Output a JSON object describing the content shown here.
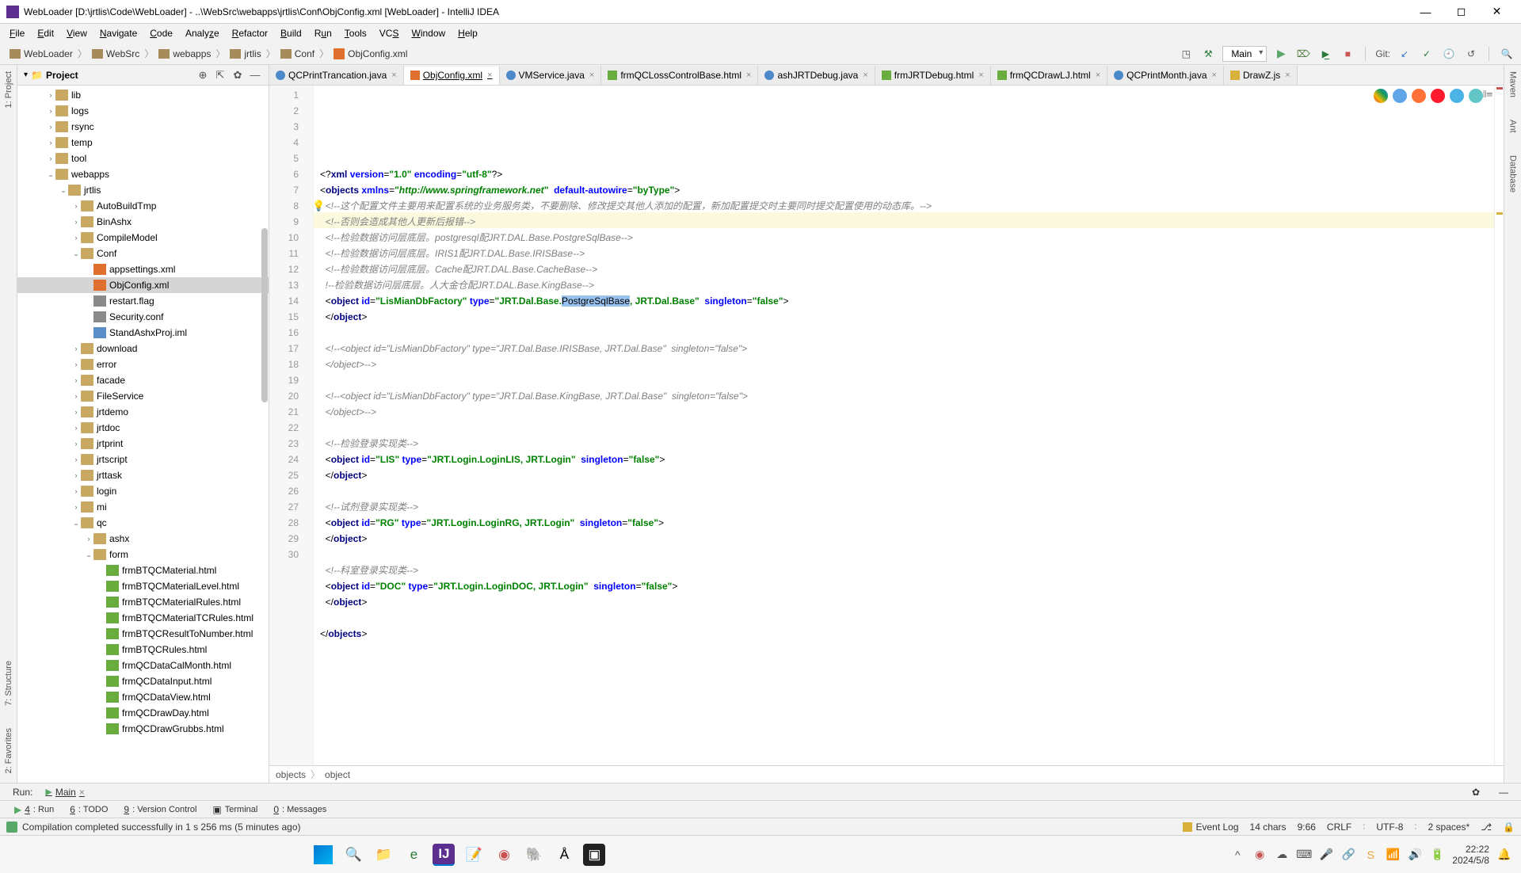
{
  "window": {
    "title": "WebLoader [D:\\jrtlis\\Code\\WebLoader] - ..\\WebSrc\\webapps\\jrtlis\\Conf\\ObjConfig.xml [WebLoader] - IntelliJ IDEA",
    "minimize": "—",
    "maximize": "◻",
    "close": "✕"
  },
  "menu": {
    "items": [
      "File",
      "Edit",
      "View",
      "Navigate",
      "Code",
      "Analyze",
      "Refactor",
      "Build",
      "Run",
      "Tools",
      "VCS",
      "Window",
      "Help"
    ]
  },
  "breadcrumb": {
    "root": "WebLoader",
    "parts": [
      "WebSrc",
      "webapps",
      "jrtlis",
      "Conf",
      "ObjConfig.xml"
    ]
  },
  "toolbar": {
    "run_config": "Main",
    "git_label": "Git:"
  },
  "project": {
    "header": "Project",
    "nodes": [
      {
        "indent": 1,
        "type": "folder",
        "arrow": "›",
        "label": "lib"
      },
      {
        "indent": 1,
        "type": "folder",
        "arrow": "›",
        "label": "logs"
      },
      {
        "indent": 1,
        "type": "folder",
        "arrow": "›",
        "label": "rsync"
      },
      {
        "indent": 1,
        "type": "folder",
        "arrow": "›",
        "label": "temp"
      },
      {
        "indent": 1,
        "type": "folder",
        "arrow": "›",
        "label": "tool"
      },
      {
        "indent": 1,
        "type": "folder",
        "arrow": "⌄",
        "label": "webapps"
      },
      {
        "indent": 2,
        "type": "folder",
        "arrow": "⌄",
        "label": "jrtlis"
      },
      {
        "indent": 3,
        "type": "folder",
        "arrow": "›",
        "label": "AutoBuildTmp"
      },
      {
        "indent": 3,
        "type": "folder",
        "arrow": "›",
        "label": "BinAshx"
      },
      {
        "indent": 3,
        "type": "folder",
        "arrow": "›",
        "label": "CompileModel"
      },
      {
        "indent": 3,
        "type": "folder",
        "arrow": "⌄",
        "label": "Conf"
      },
      {
        "indent": 4,
        "type": "file-xml",
        "arrow": "",
        "label": "appsettings.xml"
      },
      {
        "indent": 4,
        "type": "file-xml",
        "arrow": "",
        "label": "ObjConfig.xml",
        "selected": true
      },
      {
        "indent": 4,
        "type": "file-txt",
        "arrow": "",
        "label": "restart.flag"
      },
      {
        "indent": 4,
        "type": "file-txt",
        "arrow": "",
        "label": "Security.conf"
      },
      {
        "indent": 4,
        "type": "file-iml",
        "arrow": "",
        "label": "StandAshxProj.iml"
      },
      {
        "indent": 3,
        "type": "folder",
        "arrow": "›",
        "label": "download"
      },
      {
        "indent": 3,
        "type": "folder",
        "arrow": "›",
        "label": "error"
      },
      {
        "indent": 3,
        "type": "folder",
        "arrow": "›",
        "label": "facade"
      },
      {
        "indent": 3,
        "type": "folder",
        "arrow": "›",
        "label": "FileService"
      },
      {
        "indent": 3,
        "type": "folder",
        "arrow": "›",
        "label": "jrtdemo"
      },
      {
        "indent": 3,
        "type": "folder",
        "arrow": "›",
        "label": "jrtdoc"
      },
      {
        "indent": 3,
        "type": "folder",
        "arrow": "›",
        "label": "jrtprint"
      },
      {
        "indent": 3,
        "type": "folder",
        "arrow": "›",
        "label": "jrtscript"
      },
      {
        "indent": 3,
        "type": "folder",
        "arrow": "›",
        "label": "jrttask"
      },
      {
        "indent": 3,
        "type": "folder",
        "arrow": "›",
        "label": "login"
      },
      {
        "indent": 3,
        "type": "folder",
        "arrow": "›",
        "label": "mi"
      },
      {
        "indent": 3,
        "type": "folder",
        "arrow": "⌄",
        "label": "qc"
      },
      {
        "indent": 4,
        "type": "folder",
        "arrow": "›",
        "label": "ashx"
      },
      {
        "indent": 4,
        "type": "folder",
        "arrow": "⌄",
        "label": "form"
      },
      {
        "indent": 5,
        "type": "file-html",
        "arrow": "",
        "label": "frmBTQCMaterial.html"
      },
      {
        "indent": 5,
        "type": "file-html",
        "arrow": "",
        "label": "frmBTQCMaterialLevel.html"
      },
      {
        "indent": 5,
        "type": "file-html",
        "arrow": "",
        "label": "frmBTQCMaterialRules.html"
      },
      {
        "indent": 5,
        "type": "file-html",
        "arrow": "",
        "label": "frmBTQCMaterialTCRules.html"
      },
      {
        "indent": 5,
        "type": "file-html",
        "arrow": "",
        "label": "frmBTQCResultToNumber.html"
      },
      {
        "indent": 5,
        "type": "file-html",
        "arrow": "",
        "label": "frmBTQCRules.html"
      },
      {
        "indent": 5,
        "type": "file-html",
        "arrow": "",
        "label": "frmQCDataCalMonth.html"
      },
      {
        "indent": 5,
        "type": "file-html",
        "arrow": "",
        "label": "frmQCDataInput.html"
      },
      {
        "indent": 5,
        "type": "file-html",
        "arrow": "",
        "label": "frmQCDataView.html"
      },
      {
        "indent": 5,
        "type": "file-html",
        "arrow": "",
        "label": "frmQCDrawDay.html"
      },
      {
        "indent": 5,
        "type": "file-html",
        "arrow": "",
        "label": "frmQCDrawGrubbs.html"
      }
    ]
  },
  "tabs": [
    {
      "icon": "java",
      "label": "QCPrintTrancation.java"
    },
    {
      "icon": "xml",
      "label": "ObjConfig.xml",
      "active": true
    },
    {
      "icon": "java",
      "label": "VMService.java"
    },
    {
      "icon": "html",
      "label": "frmQCLossControlBase.html"
    },
    {
      "icon": "java",
      "label": "ashJRTDebug.java"
    },
    {
      "icon": "html",
      "label": "frmJRTDebug.html"
    },
    {
      "icon": "html",
      "label": "frmQCDrawLJ.html"
    },
    {
      "icon": "java",
      "label": "QCPrintMonth.java"
    },
    {
      "icon": "js",
      "label": "DrawZ.js"
    }
  ],
  "code": {
    "line1_pi": "<?xml version=\"1.0\" encoding=\"utf-8\"?>",
    "line2_a": "objects",
    "line2_b": "xmlns",
    "line2_c": "http://www.springframework.net",
    "line2_d": "default-autowire",
    "line2_e": "byType",
    "line3": "<!--这个配置文件主要用来配置系统的业务服务类，不要删除、修改提交其他人添加的配置，新加配置提交时主要同时提交配置使用的动态库。-->",
    "line4": "<!--否则会造成其他人更新后报错-->",
    "line5a": "<!--检验数据访问层底层。",
    "line5b": "postgresql配JRT.DAL.Base.PostgreSqlBase-->",
    "line6a": "<!--检验数据访问层底层。",
    "line6b": "IRIS1配JRT.DAL.Base.IRISBase-->",
    "line7a": "<!--检验数据访问层底层。",
    "line7b": "Cache配JRT.DAL.Base.CacheBase-->",
    "line8a": "!--检验数据访问层底层。人大金仓配",
    "line8b": "JRT.DAL.Base.KingBase-->",
    "line9_id": "LisMianDbFactory",
    "line9_type_a": "JRT.Dal.Base.",
    "line9_sel": "PostgreSqlBase",
    "line9_type_b": ", JRT.Dal.Base",
    "line9_single": "false",
    "line10": "</object>",
    "line12": "<!--<object id=\"LisMianDbFactory\" type=\"JRT.Dal.Base.IRISBase, JRT.Dal.Base\"  singleton=\"false\">",
    "line13": "</object>-->",
    "line15": "<!--<object id=\"LisMianDbFactory\" type=\"JRT.Dal.Base.KingBase, JRT.Dal.Base\"  singleton=\"false\">",
    "line16": "</object>-->",
    "line18": "<!--检验登录实现类-->",
    "line19_id": "LIS",
    "line19_type": "JRT.Login.LoginLIS, JRT.Login",
    "line19_s": "false",
    "line20": "</object>",
    "line22": "<!--试剂登录实现类-->",
    "line23_id": "RG",
    "line23_type": "JRT.Login.LoginRG, JRT.Login",
    "line23_s": "false",
    "line24": "</object>",
    "line26": "<!--科室登录实现类-->",
    "line27_id": "DOC",
    "line27_type": "JRT.Login.LoginDOC, JRT.Login",
    "line27_s": "false",
    "line28": "</object>",
    "line30": "</objects>"
  },
  "editor_breadcrumb": {
    "p1": "objects",
    "p2": "object"
  },
  "gutters": {
    "left": [
      "1: Project",
      "2: Favorites",
      "7: Structure"
    ],
    "right": [
      "Maven",
      "Ant",
      "Database"
    ]
  },
  "run_bar": {
    "label": "Run:",
    "config": "Main"
  },
  "bottom_tools": {
    "items": [
      {
        "num": "4",
        "label": "Run",
        "play": true
      },
      {
        "num": "6",
        "label": "TODO"
      },
      {
        "num": "9",
        "label": "Version Control"
      },
      {
        "num": "",
        "label": "Terminal",
        "icon": "▣"
      },
      {
        "num": "0",
        "label": "Messages"
      }
    ]
  },
  "status": {
    "message": "Compilation completed successfully in 1 s 256 ms (5 minutes ago)",
    "chars": "14 chars",
    "pos": "9:66",
    "le": "CRLF",
    "enc": "UTF-8",
    "indent": "2 spaces*",
    "branch_icon": "⎇",
    "event_log": "Event Log"
  },
  "taskbar": {
    "time": "22:22",
    "date": "2024/5/8"
  }
}
